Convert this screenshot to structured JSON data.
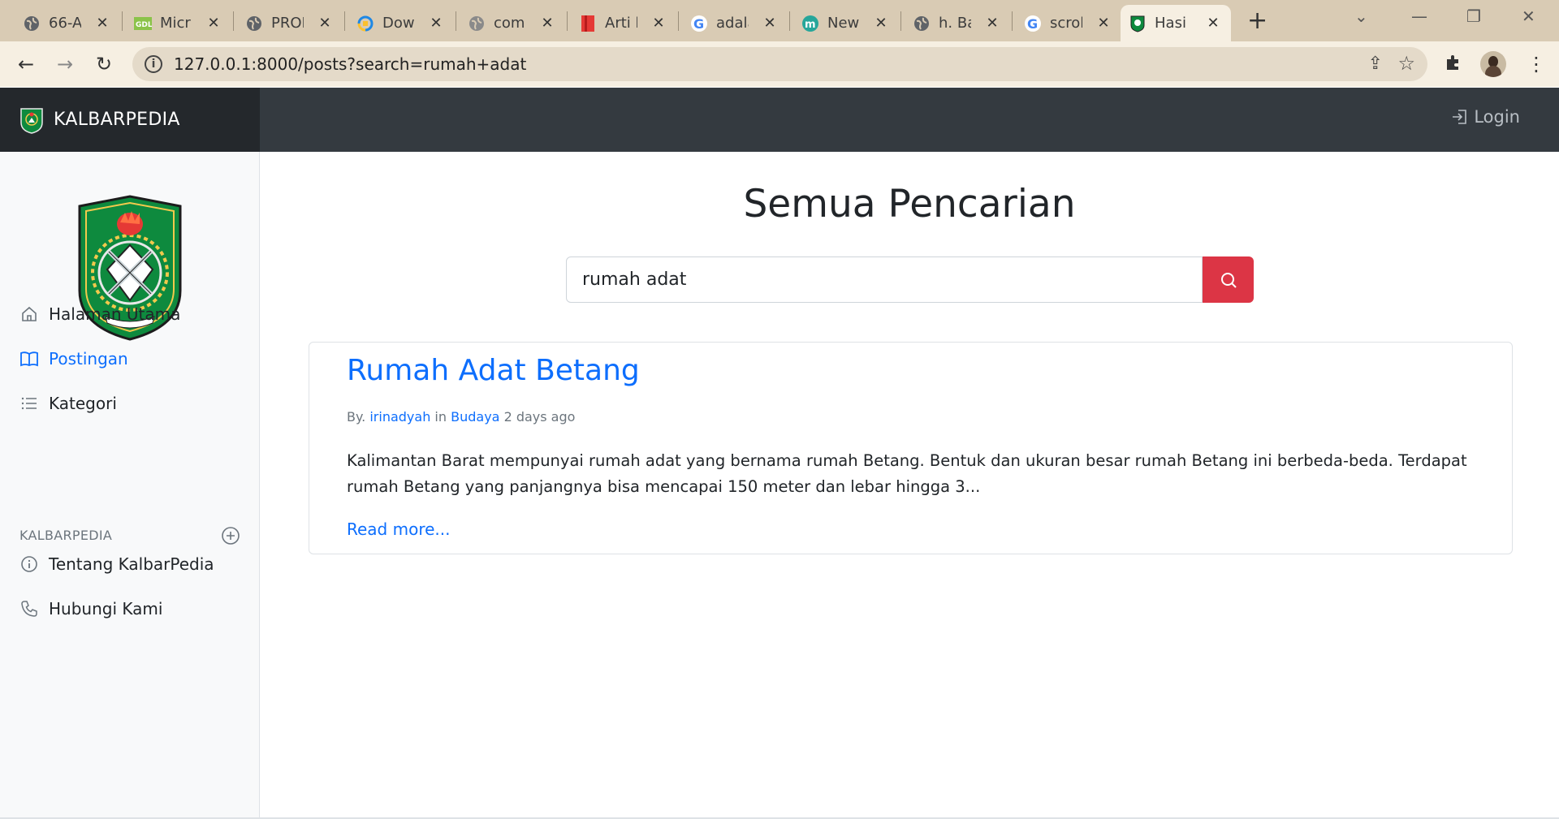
{
  "browser": {
    "tabs": [
      {
        "title": "66-A",
        "icon": "globe-icon"
      },
      {
        "title": "Micr",
        "icon": "gdl-icon"
      },
      {
        "title": "PROF",
        "icon": "globe-icon"
      },
      {
        "title": "Dow",
        "icon": "download-app-icon"
      },
      {
        "title": "comp",
        "icon": "globe-icon"
      },
      {
        "title": "Arti k",
        "icon": "bookmark-red-icon"
      },
      {
        "title": "adala",
        "icon": "google-icon"
      },
      {
        "title": "New",
        "icon": "m-letter-icon"
      },
      {
        "title": "h. Ba",
        "icon": "globe-icon"
      },
      {
        "title": "scroll",
        "icon": "google-icon"
      },
      {
        "title": "Hasil",
        "icon": "kalbar-icon",
        "active": true
      }
    ],
    "url": "127.0.0.1:8000/posts?search=rumah+adat"
  },
  "header": {
    "brand": "KALBARPEDIA",
    "login_label": "Login"
  },
  "sidebar": {
    "items": [
      {
        "label": "Halaman Utama",
        "icon": "home-icon"
      },
      {
        "label": "Postingan",
        "icon": "book-icon",
        "active": true
      },
      {
        "label": "Kategori",
        "icon": "list-icon"
      }
    ],
    "section_heading": "KALBARPEDIA",
    "section_items": [
      {
        "label": "Tentang KalbarPedia",
        "icon": "info-icon"
      },
      {
        "label": "Hubungi Kami",
        "icon": "phone-icon"
      }
    ]
  },
  "main": {
    "title": "Semua Pencarian",
    "search_value": "rumah adat",
    "post": {
      "title": "Rumah Adat Betang",
      "meta_by": "By.",
      "author": "irinadyah",
      "meta_in": "in",
      "category": "Budaya",
      "time": "2 days ago",
      "excerpt": "Kalimantan Barat mempunyai rumah adat yang bernama rumah Betang. Bentuk dan ukuran besar rumah Betang ini berbeda-beda. Terdapat rumah Betang yang panjangnya bisa mencapai 150 meter dan lebar hingga 3...",
      "read_more": "Read more..."
    }
  },
  "colors": {
    "primary": "#0d6efd",
    "danger": "#dc3545",
    "header_bg": "#343a40",
    "brand_bg": "#24282c"
  }
}
